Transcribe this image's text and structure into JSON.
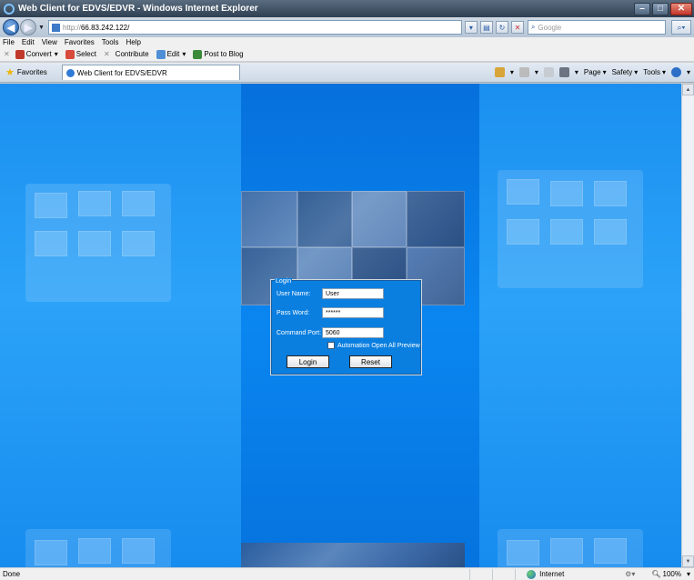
{
  "window": {
    "title": "Web Client for EDVS/EDVR - Windows Internet Explorer"
  },
  "address": {
    "protocol": "http://",
    "host": "66.83.242.122/",
    "search_placeholder": "Google"
  },
  "menu": [
    "File",
    "Edit",
    "View",
    "Favorites",
    "Tools",
    "Help"
  ],
  "toolbar": {
    "convert": "Convert",
    "select": "Select",
    "contribute": "Contribute",
    "edit": "Edit",
    "post_to_blog": "Post to Blog"
  },
  "tabs": {
    "favorites": "Favorites",
    "active_tab": "Web Client for EDVS/EDVR"
  },
  "command_bar": {
    "page": "Page",
    "safety": "Safety",
    "tools": "Tools"
  },
  "login": {
    "legend": "Login",
    "username_label": "User Name:",
    "username_value": "User",
    "password_label": "Pass Word:",
    "password_value": "******",
    "port_label": "Command Port:",
    "port_value": "5060",
    "auto_preview_label": "Automation Open All Preview",
    "login_button": "Login",
    "reset_button": "Reset"
  },
  "status": {
    "text": "Done",
    "zone": "Internet",
    "zoom": "100%"
  },
  "colors": {
    "content_blue": "#0e93f4",
    "titlebar": "#2f3f52"
  }
}
